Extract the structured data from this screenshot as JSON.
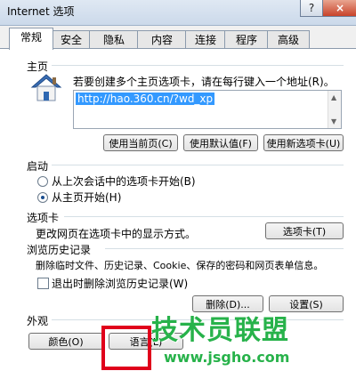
{
  "window": {
    "title": "Internet 选项",
    "help_label": "?",
    "close_label": "×"
  },
  "tabs": [
    "常规",
    "安全",
    "隐私",
    "内容",
    "连接",
    "程序",
    "高级"
  ],
  "homepage": {
    "section_label": "主页",
    "instruction": "若要创建多个主页选项卡，请在每行键入一个地址(R)。",
    "url": "http://hao.360.cn/?wd_xp",
    "buttons": [
      "使用当前页(C)",
      "使用默认值(F)",
      "使用新选项卡(U)"
    ]
  },
  "startup": {
    "section_label": "启动",
    "options": [
      "从上次会话中的选项卡开始(B)",
      "从主页开始(H)"
    ],
    "selected_index": 1
  },
  "tabs_section": {
    "section_label": "选项卡",
    "description": "更改网页在选项卡中的显示方式。",
    "button": "选项卡(T)"
  },
  "history": {
    "section_label": "浏览历史记录",
    "description": "删除临时文件、历史记录、Cookie、保存的密码和网页表单信息。",
    "checkbox_label": "退出时删除浏览历史记录(W)",
    "checkbox_checked": false,
    "delete_button": "删除(D)...",
    "settings_button": "设置(S)"
  },
  "appearance": {
    "section_label": "外观",
    "buttons": [
      "颜色(O)",
      "语言(L)"
    ]
  },
  "watermark": {
    "main": "技术员联盟",
    "url": "www.jsgho.com",
    "accent_color": "#27b24a",
    "highlight_color": "#e0001b"
  }
}
